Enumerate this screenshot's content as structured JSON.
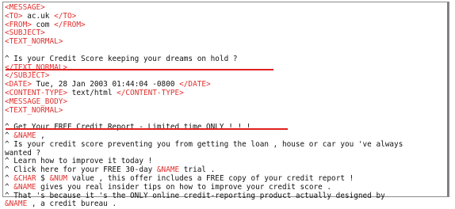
{
  "lines": [
    [
      {
        "t": "<MESSAGE>",
        "c": "tag"
      }
    ],
    [
      {
        "t": "<TO>",
        "c": "tag"
      },
      {
        "t": " ac.uk ",
        "c": "txt"
      },
      {
        "t": "</TO>",
        "c": "tag"
      }
    ],
    [
      {
        "t": "<FROM>",
        "c": "tag"
      },
      {
        "t": " com ",
        "c": "txt"
      },
      {
        "t": "</FROM>",
        "c": "tag"
      }
    ],
    [
      {
        "t": "<SUBJECT>",
        "c": "tag"
      }
    ],
    [
      {
        "t": "<TEXT_NORMAL>",
        "c": "tag"
      }
    ],
    [
      {
        "t": "",
        "c": "txt"
      }
    ],
    [
      {
        "t": "^ Is your Credit Score keeping your dreams on hold ?",
        "c": "txt"
      }
    ],
    [
      {
        "t": "</TEXT_NORMAL>",
        "c": "tag"
      }
    ],
    [
      {
        "t": "</SUBJECT>",
        "c": "tag"
      }
    ],
    [
      {
        "t": "<DATE>",
        "c": "tag"
      },
      {
        "t": " Tue, 28 Jan 2003 01:44:04 -0800 ",
        "c": "txt"
      },
      {
        "t": "</DATE>",
        "c": "tag"
      }
    ],
    [
      {
        "t": "<CONTENT-TYPE>",
        "c": "tag"
      },
      {
        "t": " text/html ",
        "c": "txt"
      },
      {
        "t": "</CONTENT-TYPE>",
        "c": "tag"
      }
    ],
    [
      {
        "t": "<MESSAGE_BODY>",
        "c": "tag"
      }
    ],
    [
      {
        "t": "<TEXT_NORMAL>",
        "c": "tag"
      }
    ],
    [
      {
        "t": "",
        "c": "txt"
      }
    ],
    [
      {
        "t": "^ Get Your FREE Credit Report - Limited time ONLY ! ! !",
        "c": "txt"
      }
    ],
    [
      {
        "t": "^ ",
        "c": "txt"
      },
      {
        "t": "&NAME",
        "c": "tag"
      },
      {
        "t": " ,",
        "c": "txt"
      }
    ],
    [
      {
        "t": "^ Is your credit score preventing you from getting the loan , house or car you 've always",
        "c": "txt"
      }
    ],
    [
      {
        "t": "wanted ?",
        "c": "txt"
      }
    ],
    [
      {
        "t": "^ Learn how to improve it today !",
        "c": "txt"
      }
    ],
    [
      {
        "t": "^ Click here for your FREE 30-day ",
        "c": "txt"
      },
      {
        "t": "&NAME",
        "c": "tag"
      },
      {
        "t": " trial .",
        "c": "txt"
      }
    ],
    [
      {
        "t": "^ ",
        "c": "txt"
      },
      {
        "t": "&CHAR",
        "c": "tag"
      },
      {
        "t": " $ ",
        "c": "txt"
      },
      {
        "t": "&NUM",
        "c": "tag"
      },
      {
        "t": " value , this offer includes a FREE copy of your credit report !",
        "c": "txt"
      }
    ],
    [
      {
        "t": "^ ",
        "c": "txt"
      },
      {
        "t": "&NAME",
        "c": "tag"
      },
      {
        "t": " gives you real insider tips on how to improve your credit score .",
        "c": "txt"
      }
    ],
    [
      {
        "t": "^ That 's because it 's the ONLY online credit-reporting product actually designed by",
        "c": "txt"
      }
    ],
    [
      {
        "t": "&NAME",
        "c": "tag"
      },
      {
        "t": " , a credit bureau .",
        "c": "txt"
      }
    ]
  ]
}
